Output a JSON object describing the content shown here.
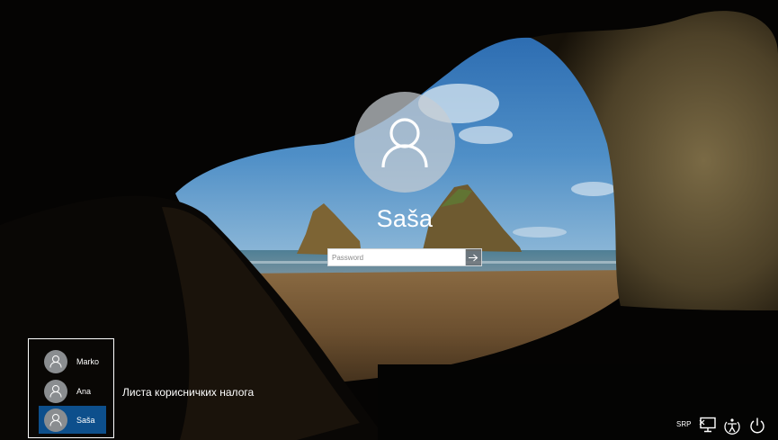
{
  "login": {
    "username": "Saša",
    "password_placeholder": "Password",
    "submit_icon": "arrow-right-icon"
  },
  "user_list": {
    "label": "Листа корисничких налога",
    "users": [
      {
        "name": "Marko",
        "icon": "user-icon",
        "selected": false
      },
      {
        "name": "Ana",
        "icon": "user-icon",
        "selected": false
      },
      {
        "name": "Saša",
        "icon": "user-icon",
        "selected": true
      }
    ]
  },
  "system_tray": {
    "language": "SRP",
    "network_icon": "network-icon",
    "ease_of_access_icon": "ease-of-access-icon",
    "power_icon": "power-icon"
  },
  "colors": {
    "selected_user": "#0d4f8c",
    "avatar_bg": "#c8cdd2",
    "text": "#ffffff"
  }
}
